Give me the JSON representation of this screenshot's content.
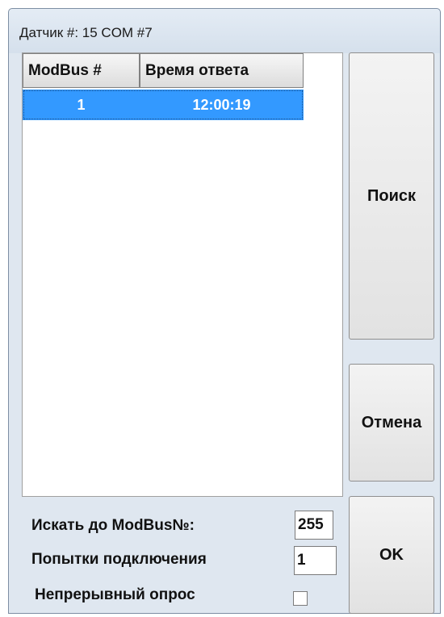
{
  "window": {
    "title": "Датчик #: 15  COM #7"
  },
  "results_table": {
    "columns": [
      "ModBus #",
      "Время ответа"
    ],
    "rows": [
      {
        "modbus": "1",
        "response_time": "12:00:19"
      }
    ]
  },
  "buttons": {
    "search": "Поиск",
    "cancel": "Отмена",
    "ok": "OK"
  },
  "fields": {
    "search_up_to_label": "Искать до ModBus№:",
    "search_up_to_value": "255",
    "attempts_label": "Попытки подключения",
    "attempts_value": "1",
    "continuous_label": "Непрерывный опрос",
    "continuous_checked": false
  }
}
